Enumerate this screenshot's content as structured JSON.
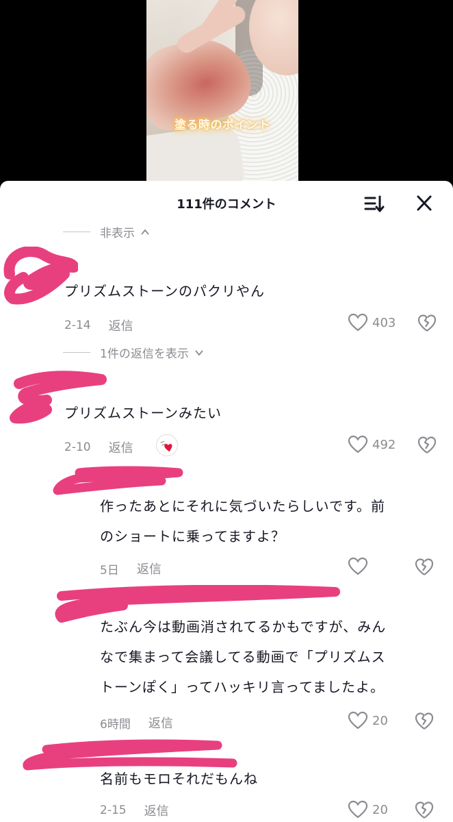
{
  "video": {
    "caption": "塗る時のポイント"
  },
  "sheet": {
    "title": "111件のコメント",
    "sort_icon": "sort-icon",
    "close_icon": "close-icon"
  },
  "comments": [
    {
      "hide_replies": "非表示",
      "text": "プリズムストーンのパクリやん",
      "date": "2-14",
      "reply": "返信",
      "likes": "403",
      "view_replies": "1件の返信を表示"
    },
    {
      "text": "プリズムストーンみたい",
      "date": "2-10",
      "reply": "返信",
      "likes": "492",
      "badge_icon": "creator-liked-icon"
    }
  ],
  "replies": [
    {
      "text_line1": "作ったあとにそれに気づいたらしいです。前",
      "text_line2": "のショートに乗ってますよ？",
      "date": "5日",
      "reply": "返信",
      "likes": ""
    },
    {
      "text_line1": "たぶん今は動画消されてるかもですが、みん",
      "text_line2": "なで集まって会議してる動画で「プリズムス",
      "text_line3": "トーンぽく」ってハッキリ言ってましたよ。",
      "date": "6時間",
      "reply": "返信",
      "likes": "20"
    },
    {
      "text_line1": "名前もモロそれだもんね",
      "date": "2-15",
      "reply": "返信",
      "likes": "20"
    }
  ],
  "colors": {
    "scribble": "#e8407f",
    "muted": "#8a8b91",
    "text": "#161823"
  }
}
